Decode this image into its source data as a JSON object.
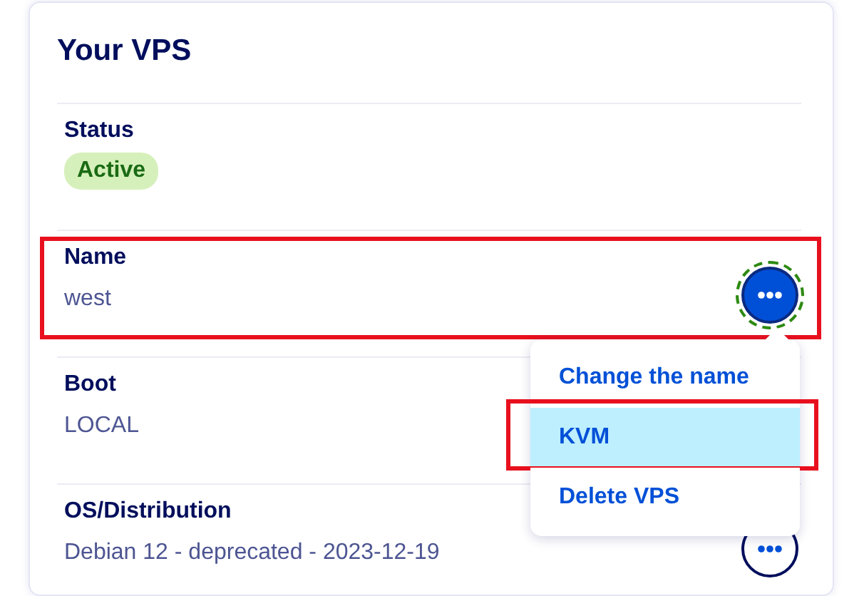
{
  "card": {
    "title": "Your VPS"
  },
  "rows": [
    {
      "label": "Status",
      "kind": "badge",
      "value": "Active",
      "highlighted": false,
      "menu_button": false
    },
    {
      "label": "Name",
      "kind": "text",
      "value": "west",
      "highlighted": true,
      "menu_button": true,
      "focused": true
    },
    {
      "label": "Boot",
      "kind": "text",
      "value": "LOCAL",
      "highlighted": false,
      "menu_button": false
    },
    {
      "label": "OS/Distribution",
      "kind": "text",
      "value": "Debian 12 - deprecated - 2023-12-19",
      "highlighted": false,
      "menu_button": true,
      "focused": false
    }
  ],
  "menu": {
    "items": [
      {
        "label": "Change the name",
        "selected": false,
        "highlighted": false
      },
      {
        "label": "KVM",
        "selected": true,
        "highlighted": true
      },
      {
        "label": "Delete VPS",
        "selected": false,
        "highlighted": false
      }
    ]
  }
}
